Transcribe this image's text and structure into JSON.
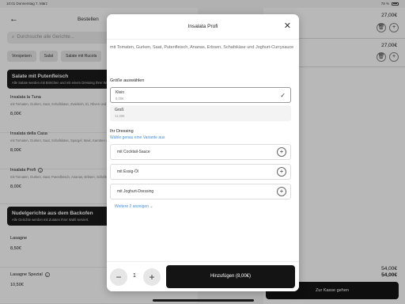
{
  "statusbar": {
    "time": "10:01",
    "date": "Donnerstag 7. März",
    "battery": "78 %"
  },
  "left": {
    "title": "Bestellen",
    "search_placeholder": "Durchsuche alle Gerichte...",
    "chips": [
      "Vorspeisen",
      "Salat",
      "Salate mit Rucola"
    ],
    "categories": [
      {
        "title": "Salate mit Putenfleisch",
        "desc": "Alle Salate werden mit Brötchen und mit einem Dressing Ihrer Wahl serviert."
      },
      {
        "title": "Nudelgerichte aus dem Backofen",
        "desc": "Alle Gerichte werden mit Zutaten Ihrer Wahl serviert."
      }
    ],
    "items": [
      {
        "name": "Insalata la Tuna",
        "desc": "mit Tomaten, Gurken, Saat, Schafskäse, Zwiebeln, Ei, Oliven und Thunfisch",
        "price": "8,00€"
      },
      {
        "name": "Insalata della Casa",
        "desc": "mit Tomaten, Gurken, Saat, Schafskäse, Spargel, Mais, Karotten und Ei",
        "price": "8,00€"
      },
      {
        "name": "Insalata Profi",
        "desc": "mit Tomaten, Gurken, Saat, Putenfleisch, Ananas, Erbsen, Schafskäse",
        "price": "8,00€"
      },
      {
        "name": "Lasagne",
        "desc": "",
        "price": "8,50€"
      },
      {
        "name": "Lasagne Spezial",
        "desc": "",
        "price": "10,50€"
      }
    ]
  },
  "cart": {
    "lines": [
      {
        "price": "27,00€"
      },
      {
        "price": "27,00€"
      }
    ],
    "total_1": "54,00€",
    "total_2": "54,00€",
    "checkout_label": "Zur Kasse gehen"
  },
  "modal": {
    "title": "Insalata Profi",
    "description": "mit Tomaten, Gurken, Saat, Putenfleisch, Ananas, Erbsen, Schafskäse und Joghurt-Currysauce",
    "size_section": "Größe auswählen",
    "sizes": [
      {
        "name": "Klein",
        "price": "8,00€",
        "selected": true
      },
      {
        "name": "Groß",
        "price": "11,00€",
        "selected": false
      }
    ],
    "dressing_section": "Ihr Dressing",
    "dressing_hint": "Wähle genau eine Variante aus",
    "dressings": [
      "mit Cocktail-Sauce",
      "mit Essig-Öl",
      "mit Joghurt-Dressing"
    ],
    "more_label": "Weitere 2 anzeigen",
    "quantity": "1",
    "add_label": "Hinzufügen (8,00€)"
  },
  "icons": {
    "back": "arrow-left-icon",
    "close": "close-icon",
    "check": "checkmark-icon",
    "plus": "plus-icon",
    "minus": "minus-icon",
    "chevron": "chevron-down-icon",
    "info": "info-icon",
    "trash": "trash-icon",
    "search": "search-icon"
  },
  "colors": {
    "accent_link": "#4a90d9",
    "primary_button": "#141414"
  }
}
